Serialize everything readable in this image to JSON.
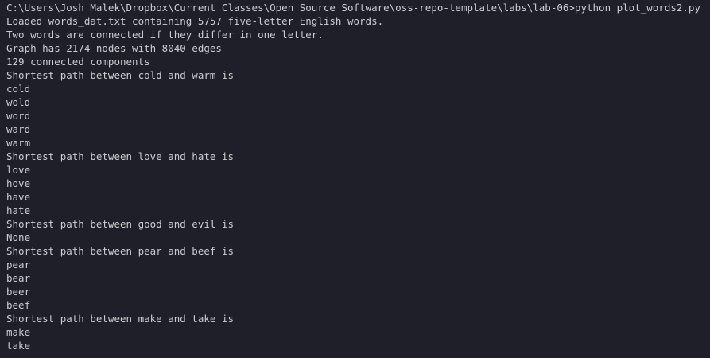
{
  "terminal": {
    "background": "#1e1f29",
    "foreground": "#cccccc",
    "lines": [
      "C:\\Users\\Josh Malek\\Dropbox\\Current Classes\\Open Source Software\\oss-repo-template\\labs\\lab-06>python plot_words2.py",
      "Loaded words_dat.txt containing 5757 five-letter English words.",
      "Two words are connected if they differ in one letter.",
      "Graph has 2174 nodes with 8040 edges",
      "129 connected components",
      "Shortest path between cold and warm is",
      "cold",
      "wold",
      "word",
      "ward",
      "warm",
      "Shortest path between love and hate is",
      "love",
      "hove",
      "have",
      "hate",
      "Shortest path between good and evil is",
      "None",
      "Shortest path between pear and beef is",
      "pear",
      "bear",
      "beer",
      "beef",
      "Shortest path between make and take is",
      "make",
      "take"
    ]
  }
}
